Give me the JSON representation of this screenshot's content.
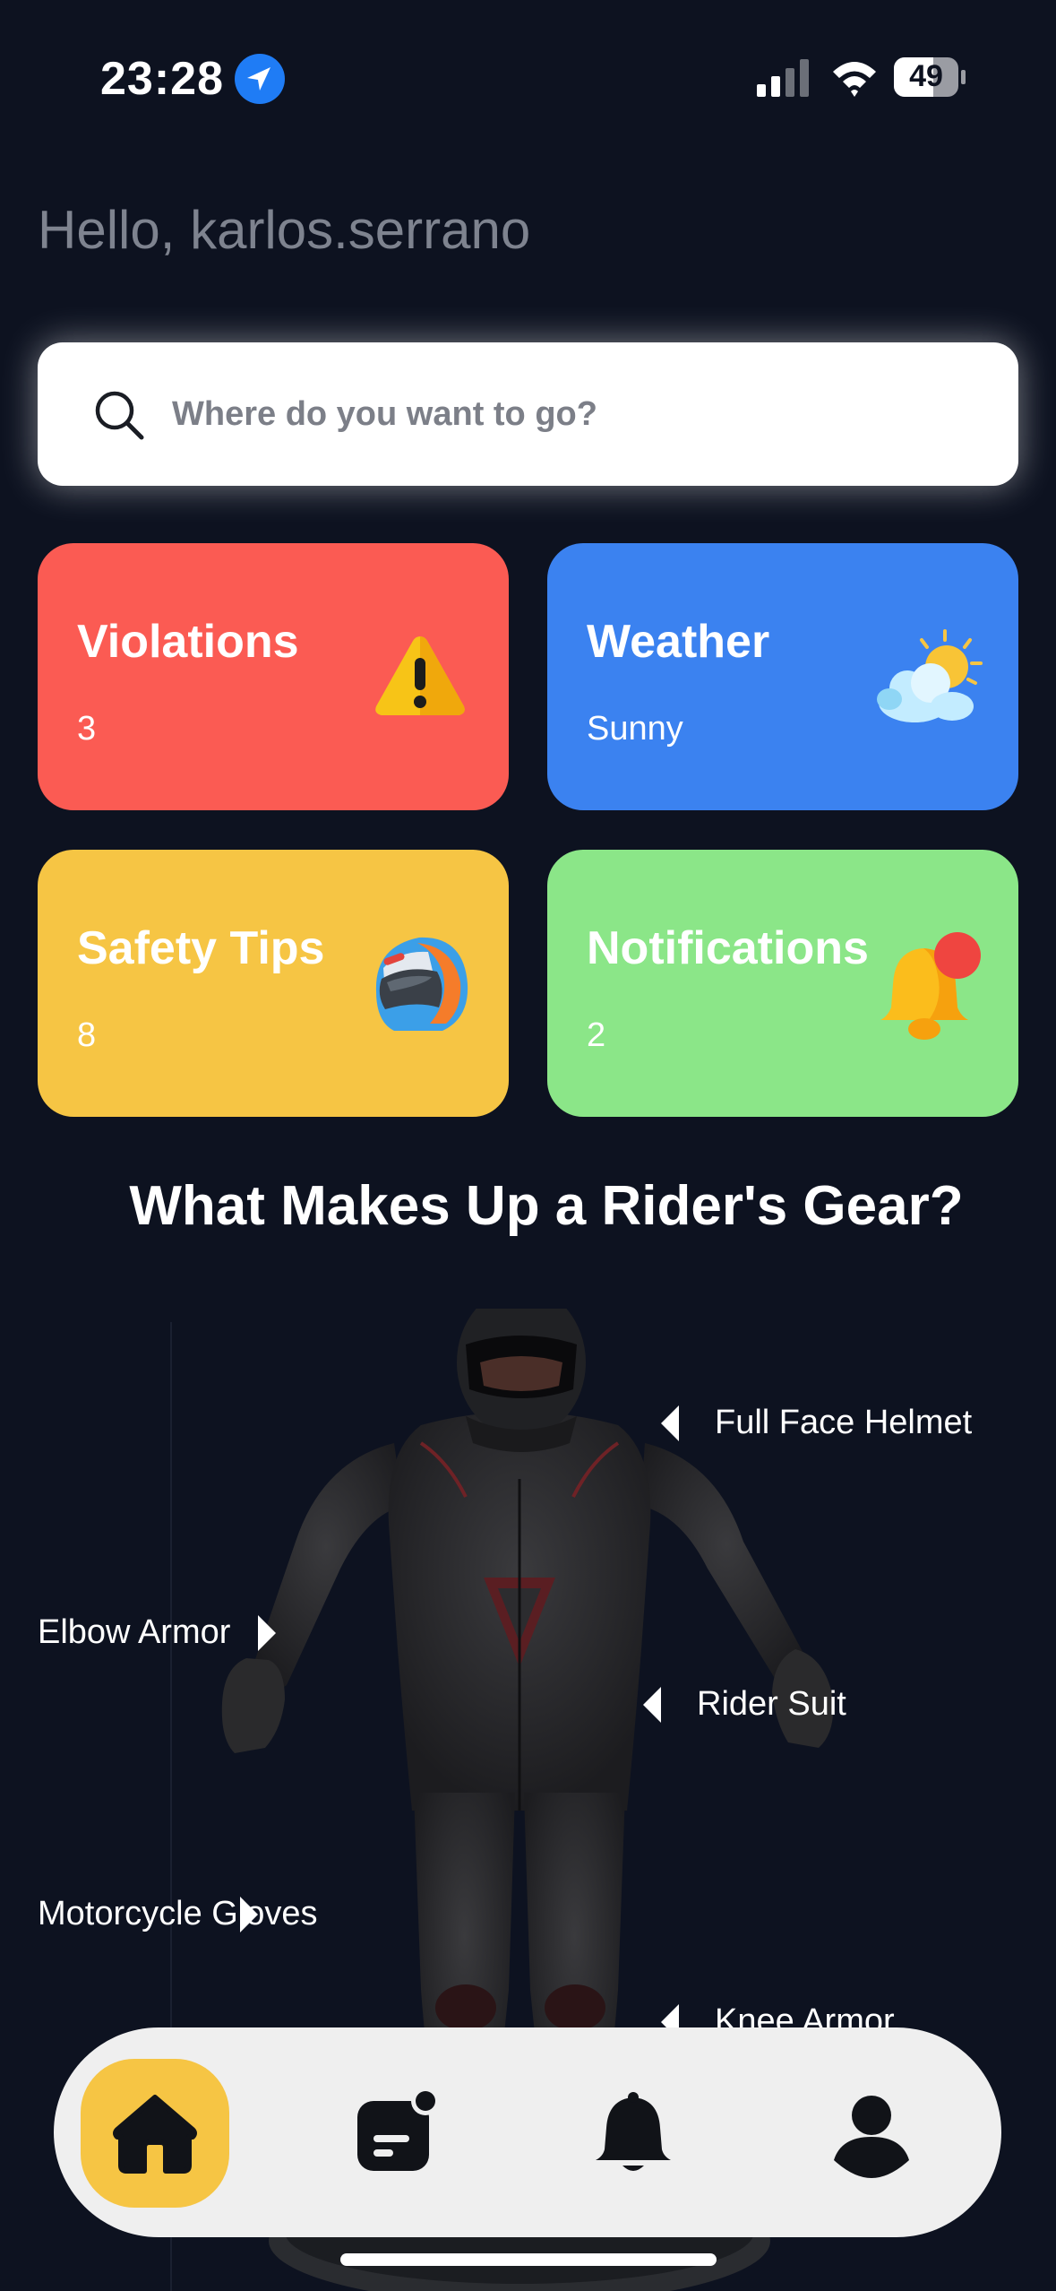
{
  "status_bar": {
    "time": "23:28",
    "battery": "49"
  },
  "greeting": "Hello, karlos.serrano",
  "search": {
    "placeholder": "Where do you want to go?"
  },
  "cards": [
    {
      "title": "Violations",
      "value": "3",
      "color": "#fb5b53",
      "icon": "warning-icon"
    },
    {
      "title": "Weather",
      "value": "Sunny",
      "color": "#3b82f0",
      "icon": "sun-cloud-icon"
    },
    {
      "title": "Safety Tips",
      "value": "8",
      "color": "#f6c544",
      "icon": "helmet-icon"
    },
    {
      "title": "Notifications",
      "value": "2",
      "color": "#8be688",
      "icon": "bell-icon"
    }
  ],
  "gear_section": {
    "title": "What Makes Up a Rider's Gear?",
    "labels": [
      "Full Face Helmet",
      "Elbow Armor",
      "Rider Suit",
      "Motorcycle Gloves",
      "Knee Armor"
    ]
  },
  "bottom_nav": {
    "items": [
      "home-icon",
      "news-icon",
      "bell-icon",
      "profile-icon"
    ],
    "active": "home-icon",
    "active_color": "#f6c544"
  }
}
